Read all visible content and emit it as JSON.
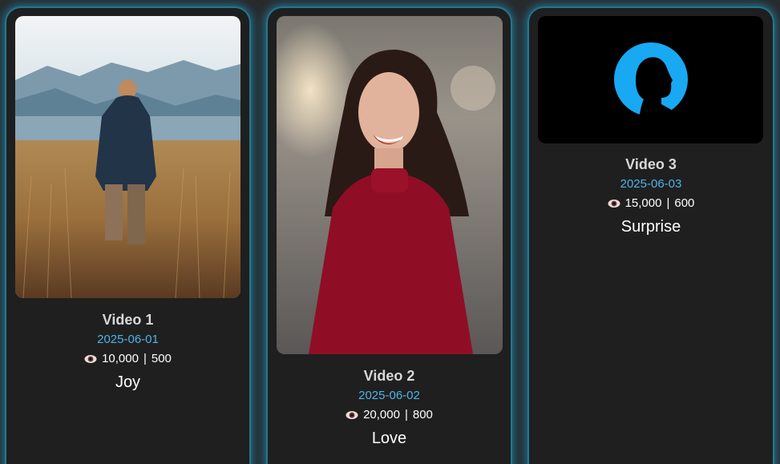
{
  "videos": [
    {
      "title": "Video 1",
      "date": "2025-06-01",
      "views": "10,000",
      "separator": "|",
      "likes": "500",
      "emotion": "Joy",
      "stats_icon": "eye-icon",
      "thumbnail": "man-in-field-mountains"
    },
    {
      "title": "Video 2",
      "date": "2025-06-02",
      "views": "20,000",
      "separator": "|",
      "likes": "800",
      "emotion": "Love",
      "stats_icon": "eye-icon",
      "thumbnail": "smiling-woman-red-top"
    },
    {
      "title": "Video 3",
      "date": "2025-06-03",
      "views": "15,000",
      "separator": "|",
      "likes": "600",
      "emotion": "Surprise",
      "stats_icon": "eye-icon",
      "thumbnail": "silhouette-blue-circle"
    }
  ],
  "colors": {
    "page_bg": "#2a2a2a",
    "card_bg": "#1f1f1f",
    "card_glow": "#23a0c8",
    "date_text": "#4fb3e8",
    "title_text": "#d8d8d8"
  }
}
